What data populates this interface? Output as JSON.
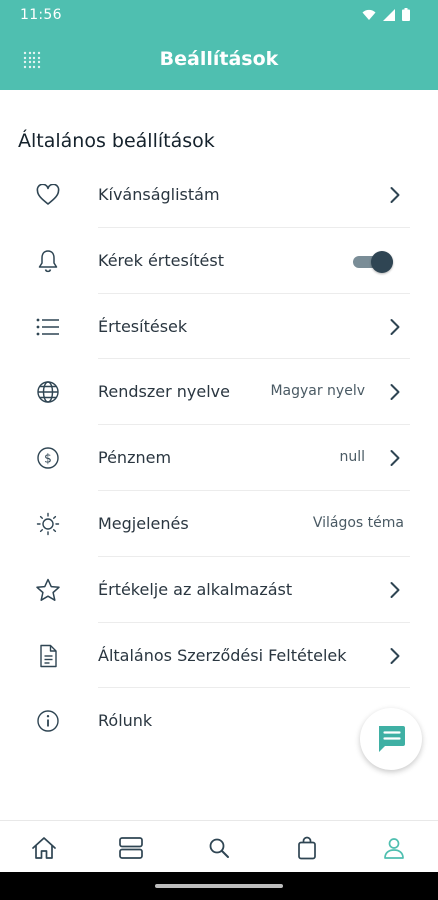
{
  "status_bar": {
    "time": "11:56"
  },
  "header": {
    "title": "Beállítások"
  },
  "section": {
    "title": "Általános beállítások"
  },
  "settings": [
    {
      "icon": "heart-icon",
      "label": "Kívánságlistám"
    },
    {
      "icon": "bell-icon",
      "label": "Kérek értesítést",
      "toggle_on": true
    },
    {
      "icon": "list-icon",
      "label": "Értesítések"
    },
    {
      "icon": "globe-icon",
      "label": "Rendszer nyelve",
      "value": "Magyar nyelv"
    },
    {
      "icon": "dollar-icon",
      "label": "Pénznem",
      "value": "null"
    },
    {
      "icon": "sun-icon",
      "label": "Megjelenés",
      "value": "Világos téma"
    },
    {
      "icon": "star-icon",
      "label": "Értékelje az alkalmazást"
    },
    {
      "icon": "document-icon",
      "label": "Általános Szerződési Feltételek"
    },
    {
      "icon": "info-icon",
      "label": "Rólunk"
    }
  ],
  "bottom_nav": [
    {
      "icon": "home-icon"
    },
    {
      "icon": "categories-icon"
    },
    {
      "icon": "search-icon"
    },
    {
      "icon": "bag-icon"
    },
    {
      "icon": "profile-icon",
      "active": true
    }
  ],
  "colors": {
    "accent": "#4fbfb0",
    "icon": "#2f4553",
    "nav_active": "#4fbfb0"
  }
}
